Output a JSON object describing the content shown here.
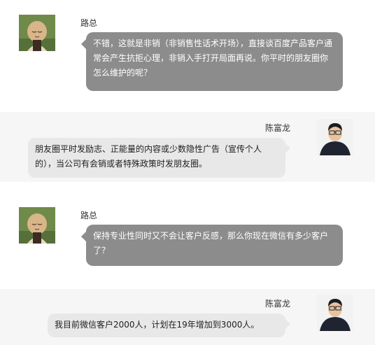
{
  "messages": [
    {
      "sender": "路总",
      "side": "left",
      "text": "不错，这就是非销（非销售性话术开场），直接谈百度产品客户通常会产生抗拒心理，非销入手打开局面再说。你平时的朋友圈你怎么维护的呢？"
    },
    {
      "sender": "陈富龙",
      "side": "right",
      "text": "朋友圈平时发励志、正能量的内容或少数隐性广告（宣传个人的），当公司有会销或者特殊政策时发朋友圈。"
    },
    {
      "sender": "路总",
      "side": "left",
      "text": "保持专业性同时又不会让客户反感，那么你现在微信有多少客户了？"
    },
    {
      "sender": "陈富龙",
      "side": "right",
      "text": "我目前微信客户2000人，计划在19年增加到3000人。"
    }
  ],
  "colors": {
    "left_bubble": "#8c8c8c",
    "right_bubble": "#e8e8e8"
  },
  "icons": {
    "left_avatar": "avatar-monk-icon",
    "right_avatar": "avatar-man-icon"
  }
}
